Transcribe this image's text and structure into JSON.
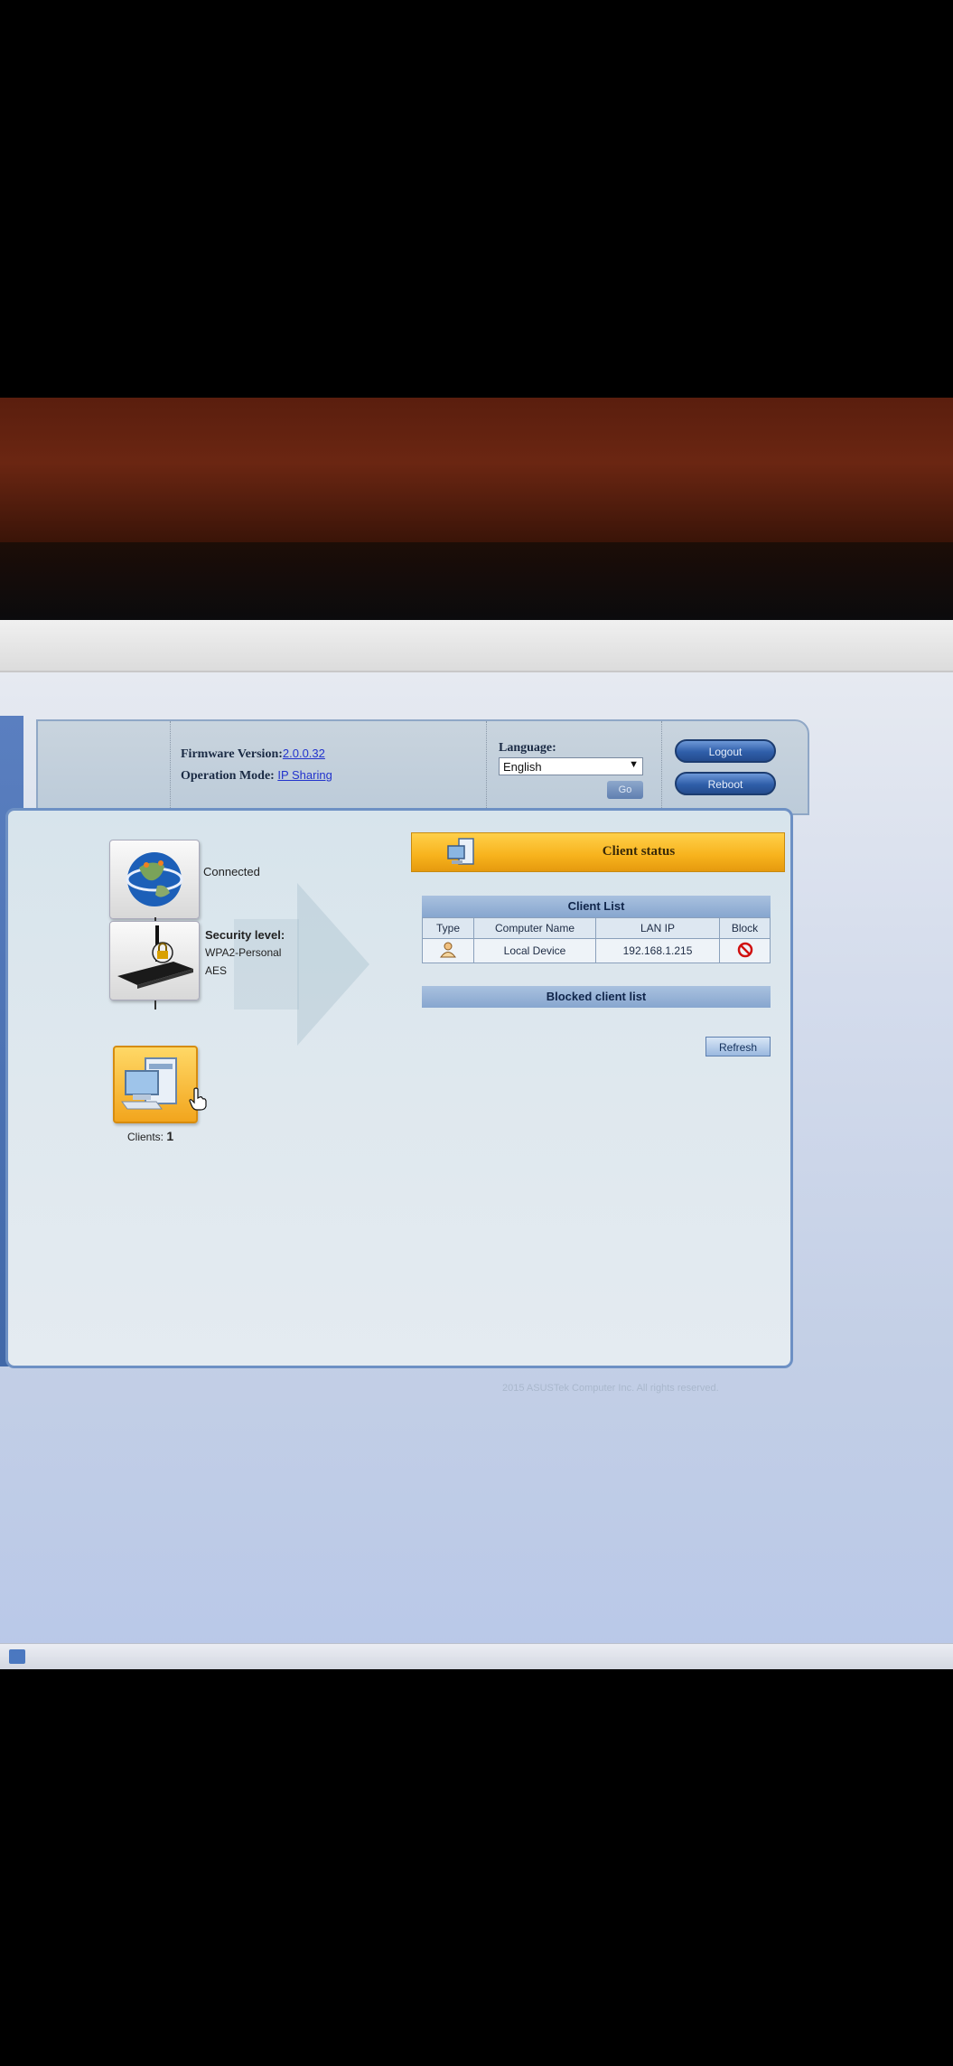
{
  "header": {
    "firmware_label": "Firmware Version:",
    "firmware_value": "2.0.0.32",
    "opmode_label": "Operation Mode:",
    "opmode_value": "IP Sharing",
    "language_label": "Language:",
    "language_selected": "English",
    "go_label": "Go",
    "logout_label": "Logout",
    "reboot_label": "Reboot"
  },
  "network_map": {
    "internet_status": "Connected",
    "security_label": "Security level:",
    "security_mode": "WPA2-Personal",
    "security_cipher": "AES",
    "clients_label": "Clients:",
    "clients_count": "1"
  },
  "client_status": {
    "title": "Client status",
    "client_list_title": "Client List",
    "columns": [
      "Type",
      "Computer Name",
      "LAN IP",
      "Block"
    ],
    "rows": [
      {
        "computer_name": "Local Device",
        "lan_ip": "192.168.1.215"
      }
    ],
    "blocked_list_title": "Blocked client list",
    "refresh_label": "Refresh"
  },
  "footer": {
    "copyright": "2015 ASUSTek Computer Inc. All rights reserved."
  },
  "colors": {
    "accent_orange": "#f7b21c",
    "accent_blue": "#2f5ea9",
    "block_red": "#d01010"
  }
}
